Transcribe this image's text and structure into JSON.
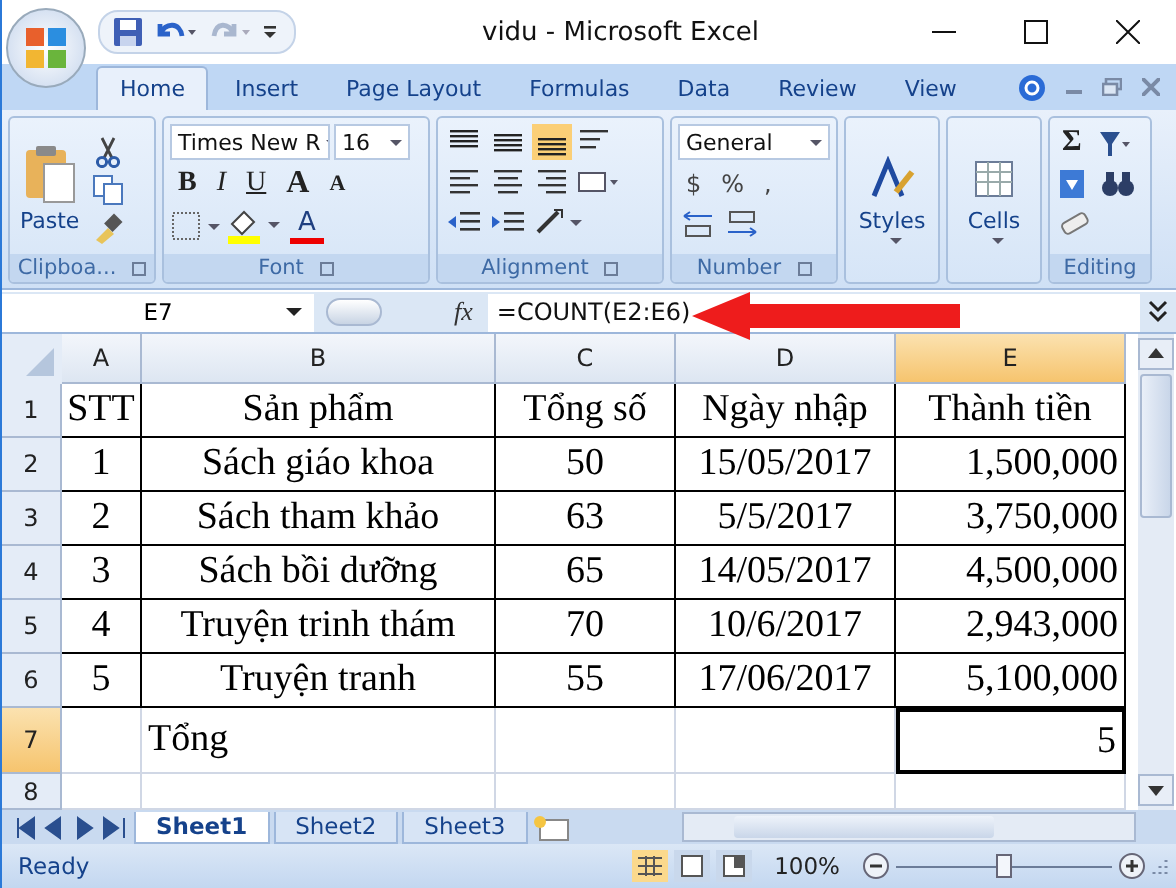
{
  "window": {
    "title": "vidu - Microsoft Excel"
  },
  "ribbon": {
    "tabs": [
      {
        "label": "Home",
        "selected": true
      },
      {
        "label": "Insert",
        "selected": false
      },
      {
        "label": "Page Layout",
        "selected": false
      },
      {
        "label": "Formulas",
        "selected": false
      },
      {
        "label": "Data",
        "selected": false
      },
      {
        "label": "Review",
        "selected": false
      },
      {
        "label": "View",
        "selected": false
      }
    ],
    "clipboard": {
      "label": "Clipboa...",
      "paste": "Paste"
    },
    "font": {
      "label": "Font",
      "font_name": "Times New R",
      "font_size": "16",
      "style_buttons": [
        {
          "label": "B",
          "kind": "bold"
        },
        {
          "label": "I",
          "kind": "italic"
        },
        {
          "label": "U",
          "kind": "underline"
        }
      ],
      "grow": "A",
      "shrink": "A",
      "font_color": "A"
    },
    "alignment": {
      "label": "Alignment",
      "vertical": [
        {
          "kind": "top",
          "selected": false
        },
        {
          "kind": "middle",
          "selected": false
        },
        {
          "kind": "bottom",
          "selected": true
        }
      ]
    },
    "number": {
      "label": "Number",
      "format": "General",
      "symbols": [
        "$",
        "%",
        ","
      ]
    },
    "styles": {
      "label": "Styles"
    },
    "cells": {
      "label": "Cells"
    },
    "editing": {
      "label": "Editing",
      "sum": "Σ"
    }
  },
  "formula_bar": {
    "name_box": "E7",
    "fx": "fx",
    "formula": "=COUNT(E2:E6)"
  },
  "sheet": {
    "columns": [
      {
        "label": "A",
        "selected": false
      },
      {
        "label": "B",
        "selected": false
      },
      {
        "label": "C",
        "selected": false
      },
      {
        "label": "D",
        "selected": false
      },
      {
        "label": "E",
        "selected": true
      }
    ],
    "rows": [
      {
        "number": "1",
        "selected": false,
        "cells": [
          "STT",
          "Sản phẩm",
          "Tổng số",
          "Ngày nhập",
          "Thành tiền"
        ]
      },
      {
        "number": "2",
        "selected": false,
        "cells": [
          "1",
          "Sách giáo khoa",
          "50",
          "15/05/2017",
          "1,500,000"
        ]
      },
      {
        "number": "3",
        "selected": false,
        "cells": [
          "2",
          "Sách tham khảo",
          "63",
          "5/5/2017",
          "3,750,000"
        ]
      },
      {
        "number": "4",
        "selected": false,
        "cells": [
          "3",
          "Sách bồi dưỡng",
          "65",
          "14/05/2017",
          "4,500,000"
        ]
      },
      {
        "number": "5",
        "selected": false,
        "cells": [
          "4",
          "Truyện trinh thám",
          "70",
          "10/6/2017",
          "2,943,000"
        ]
      },
      {
        "number": "6",
        "selected": false,
        "cells": [
          "5",
          "Truyện tranh",
          "55",
          "17/06/2017",
          "5,100,000"
        ]
      },
      {
        "number": "7",
        "selected": true,
        "cells": [
          "",
          "Tổng",
          "",
          "",
          "5"
        ]
      },
      {
        "number": "8",
        "selected": false,
        "cells": [
          "",
          "",
          "",
          "",
          ""
        ]
      }
    ]
  },
  "sheet_tabs": [
    {
      "label": "Sheet1",
      "selected": true
    },
    {
      "label": "Sheet2",
      "selected": false
    },
    {
      "label": "Sheet3",
      "selected": false
    }
  ],
  "status_bar": {
    "status": "Ready",
    "views": [
      {
        "kind": "normal",
        "selected": true
      },
      {
        "kind": "layout",
        "selected": false
      },
      {
        "kind": "break",
        "selected": false
      }
    ],
    "zoom": "100%",
    "zoom_slider": {
      "level": 0.5
    }
  }
}
